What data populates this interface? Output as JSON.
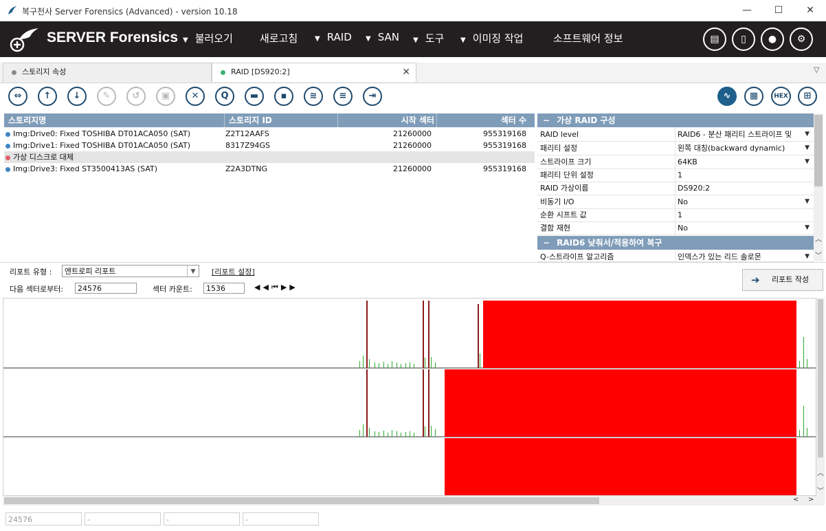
{
  "window": {
    "title": "복구천사 Server Forensics (Advanced) - version 10.18",
    "min": "—",
    "max": "☐",
    "close": "✕"
  },
  "header": {
    "brand": "SERVER Forensics",
    "menus": [
      {
        "label": "불러오기",
        "arrow": "▼"
      },
      {
        "label": "새로고침",
        "arrow": ""
      },
      {
        "label": "RAID",
        "arrow": "▼"
      },
      {
        "label": "SAN",
        "arrow": "▼"
      },
      {
        "label": "도구",
        "arrow": "▼"
      },
      {
        "label": "이미징 작업",
        "arrow": "▼"
      },
      {
        "label": "소프트웨어 정보",
        "arrow": ""
      }
    ]
  },
  "tabs": [
    {
      "label": "스토리지 속성",
      "dot_color": "#8a8a8a"
    },
    {
      "label": "RAID  [DS920:2]",
      "dot_color": "#3cb371"
    }
  ],
  "toolbar_right": {
    "hex": "HEX"
  },
  "table": {
    "headers": [
      "스토리지명",
      "스토리지 ID",
      "시작 섹터",
      "섹터 수"
    ],
    "rows": [
      {
        "name": "Img:Drive0: Fixed TOSHIBA DT01ACA050 (SAT)",
        "id": "Z2T12AAFS",
        "start": "21260000",
        "count": "955319168",
        "dot": "#3f86c6"
      },
      {
        "name": "Img:Drive1: Fixed TOSHIBA DT01ACA050 (SAT)",
        "id": "8317Z94GS",
        "start": "21260000",
        "count": "955319168",
        "dot": "#3f86c6"
      },
      {
        "name": "가상 디스크로 대체",
        "id": "",
        "start": "",
        "count": "",
        "dot": "#e0606a"
      },
      {
        "name": "Img:Drive3: Fixed ST3500413AS (SAT)",
        "id": "Z2A3DTNG",
        "start": "21260000",
        "count": "955319168",
        "dot": "#3f86c6"
      }
    ]
  },
  "props": {
    "section1": "가상 RAID 구성",
    "section2": "RAID6 낮춰서/적용하여 복구",
    "collapse": "−",
    "rows": [
      {
        "key": "RAID level",
        "value": "RAID6 - 분산 패리티 스트라이프 및",
        "dd": "▼"
      },
      {
        "key": "패리티 설정",
        "value": "왼쪽 대칭(backward dynamic)",
        "dd": "▼"
      },
      {
        "key": "스트라이프 크기",
        "value": "64KB",
        "dd": "▼"
      },
      {
        "key": "패리티 단위 설정",
        "value": "1",
        "dd": ""
      },
      {
        "key": "RAID 가상이름",
        "value": "DS920:2",
        "dd": ""
      },
      {
        "key": "비동기 I/O",
        "value": "No",
        "dd": "▼"
      },
      {
        "key": "순환 시프트 값",
        "value": "1",
        "dd": ""
      },
      {
        "key": "결함 재현",
        "value": "No",
        "dd": "▼"
      },
      {
        "key": "Q-스트라이프 알고리즘",
        "value": "인덱스가 있는 리드 솔로몬",
        "dd": "▼"
      }
    ]
  },
  "report": {
    "type_label": "리포트 유형 :",
    "type_value": "엔트로피 리포트",
    "settings_link": "[리포트 설정]",
    "from_label": "다음 섹터로부터:",
    "from_value": "24576",
    "count_label": "섹터 카운트:",
    "count_value": "1536",
    "nav": [
      "◀",
      "◀",
      "⏮",
      "▶",
      "▶"
    ],
    "create_button": "리포트 작성",
    "create_arrow": "➔"
  },
  "status_bar": [
    "24576",
    "-",
    "-",
    "-"
  ],
  "colors": {
    "header_bg": "#231f20",
    "grid_header": "#7f9cb8",
    "accent": "#1e5f8c",
    "block": "#ff0000",
    "spike_dark": "#8b1a1a",
    "spike_green": "#2ea82e"
  }
}
